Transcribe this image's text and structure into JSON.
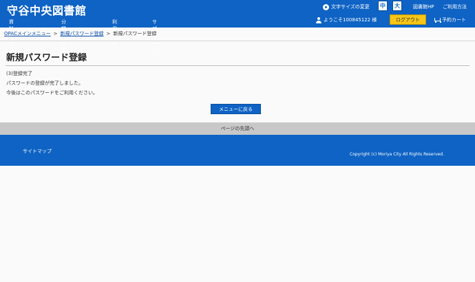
{
  "header": {
    "site_title": "守谷中央図書館",
    "font_size_label": "文字サイズの変更",
    "font_size_mid": "中",
    "font_size_large": "大",
    "link_site": "図書館HP",
    "link_help": "ご利用方法",
    "nav": [
      "資料を探す",
      "分類から探す",
      "利用照会",
      "サブメニュー"
    ],
    "user_greeting": "ようこそ100845122 様",
    "logout_label": "ログアウト",
    "cart_label": "予約カート"
  },
  "breadcrumb": {
    "items": [
      "OPACメインメニュー",
      "新規パスワード登録",
      "新規パスワード登録"
    ]
  },
  "main": {
    "title": "新規パスワード登録",
    "step": "(3)登録完了",
    "message_1": "パスワードの登録が完了しました。",
    "message_2": "今後はこのパスワードをご利用ください。",
    "menu_button": "メニューに戻る"
  },
  "back_to_top": "ページの先頭へ",
  "footer": {
    "sitemap": "サイトマップ",
    "copyright": "Copyright (c) Moriya City All Rights Reserved."
  },
  "colors": {
    "brand_blue": "#0e63c4",
    "logout_yellow": "#f5c518",
    "back_to_top_gray": "#c8c8c8"
  }
}
